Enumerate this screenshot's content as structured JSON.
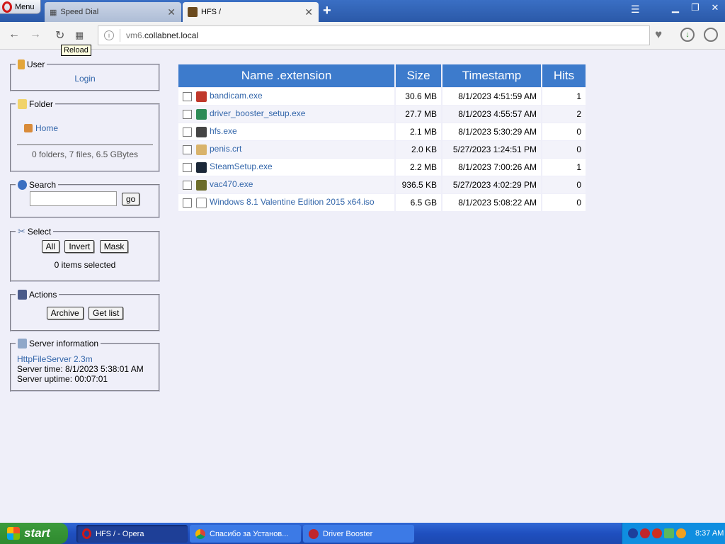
{
  "browser": {
    "menu_label": "Menu",
    "tabs": [
      {
        "label": "Speed Dial",
        "active": false
      },
      {
        "label": "HFS /",
        "active": true
      }
    ],
    "new_tab": "+",
    "url_dim": "vm6.",
    "url_main": "collabnet.local",
    "reload_tooltip": "Reload"
  },
  "sidebar": {
    "user": {
      "title": "User",
      "login": "Login"
    },
    "folder": {
      "title": "Folder",
      "home": "Home",
      "summary": "0 folders, 7 files, 6.5 GBytes"
    },
    "search": {
      "title": "Search",
      "go": "go",
      "value": ""
    },
    "select": {
      "title": "Select",
      "all": "All",
      "invert": "Invert",
      "mask": "Mask",
      "status": "0 items selected"
    },
    "actions": {
      "title": "Actions",
      "archive": "Archive",
      "get_list": "Get list"
    },
    "server": {
      "title": "Server information",
      "name": "HttpFileServer 2.3m",
      "time": "Server time: 8/1/2023 5:38:01 AM",
      "uptime": "Server uptime: 00:07:01"
    }
  },
  "files": {
    "headers": {
      "name": "Name .extension",
      "size": "Size",
      "timestamp": "Timestamp",
      "hits": "Hits"
    },
    "rows": [
      {
        "name": "bandicam.exe",
        "size": "30.6 MB",
        "timestamp": "8/1/2023 4:51:59 AM",
        "hits": "1",
        "icon": "bandicam-icon",
        "color": "#c0392b"
      },
      {
        "name": "driver_booster_setup.exe",
        "size": "27.7 MB",
        "timestamp": "8/1/2023 4:55:57 AM",
        "hits": "2",
        "icon": "installer-icon",
        "color": "#2e8b57"
      },
      {
        "name": "hfs.exe",
        "size": "2.1 MB",
        "timestamp": "8/1/2023 5:30:29 AM",
        "hits": "0",
        "icon": "hfs-icon",
        "color": "#444444"
      },
      {
        "name": "penis.crt",
        "size": "2.0 KB",
        "timestamp": "5/27/2023 1:24:51 PM",
        "hits": "0",
        "icon": "certificate-icon",
        "color": "#d9b36a"
      },
      {
        "name": "SteamSetup.exe",
        "size": "2.2 MB",
        "timestamp": "8/1/2023 7:00:26 AM",
        "hits": "1",
        "icon": "steam-icon",
        "color": "#1b2838"
      },
      {
        "name": "vac470.exe",
        "size": "936.5 KB",
        "timestamp": "5/27/2023 4:02:29 PM",
        "hits": "0",
        "icon": "vac-icon",
        "color": "#6b6b2a"
      },
      {
        "name": "Windows 8.1 Valentine Edition 2015 x64.iso",
        "size": "6.5 GB",
        "timestamp": "8/1/2023 5:08:22 AM",
        "hits": "0",
        "icon": "file-icon",
        "color": "#ffffff"
      }
    ]
  },
  "taskbar": {
    "start": "start",
    "tasks": [
      {
        "label": "HFS / - Opera",
        "active": true
      },
      {
        "label": "Спасибо за Установ...",
        "active": false
      },
      {
        "label": "Driver Booster",
        "active": false
      }
    ],
    "clock": "8:37 AM"
  }
}
